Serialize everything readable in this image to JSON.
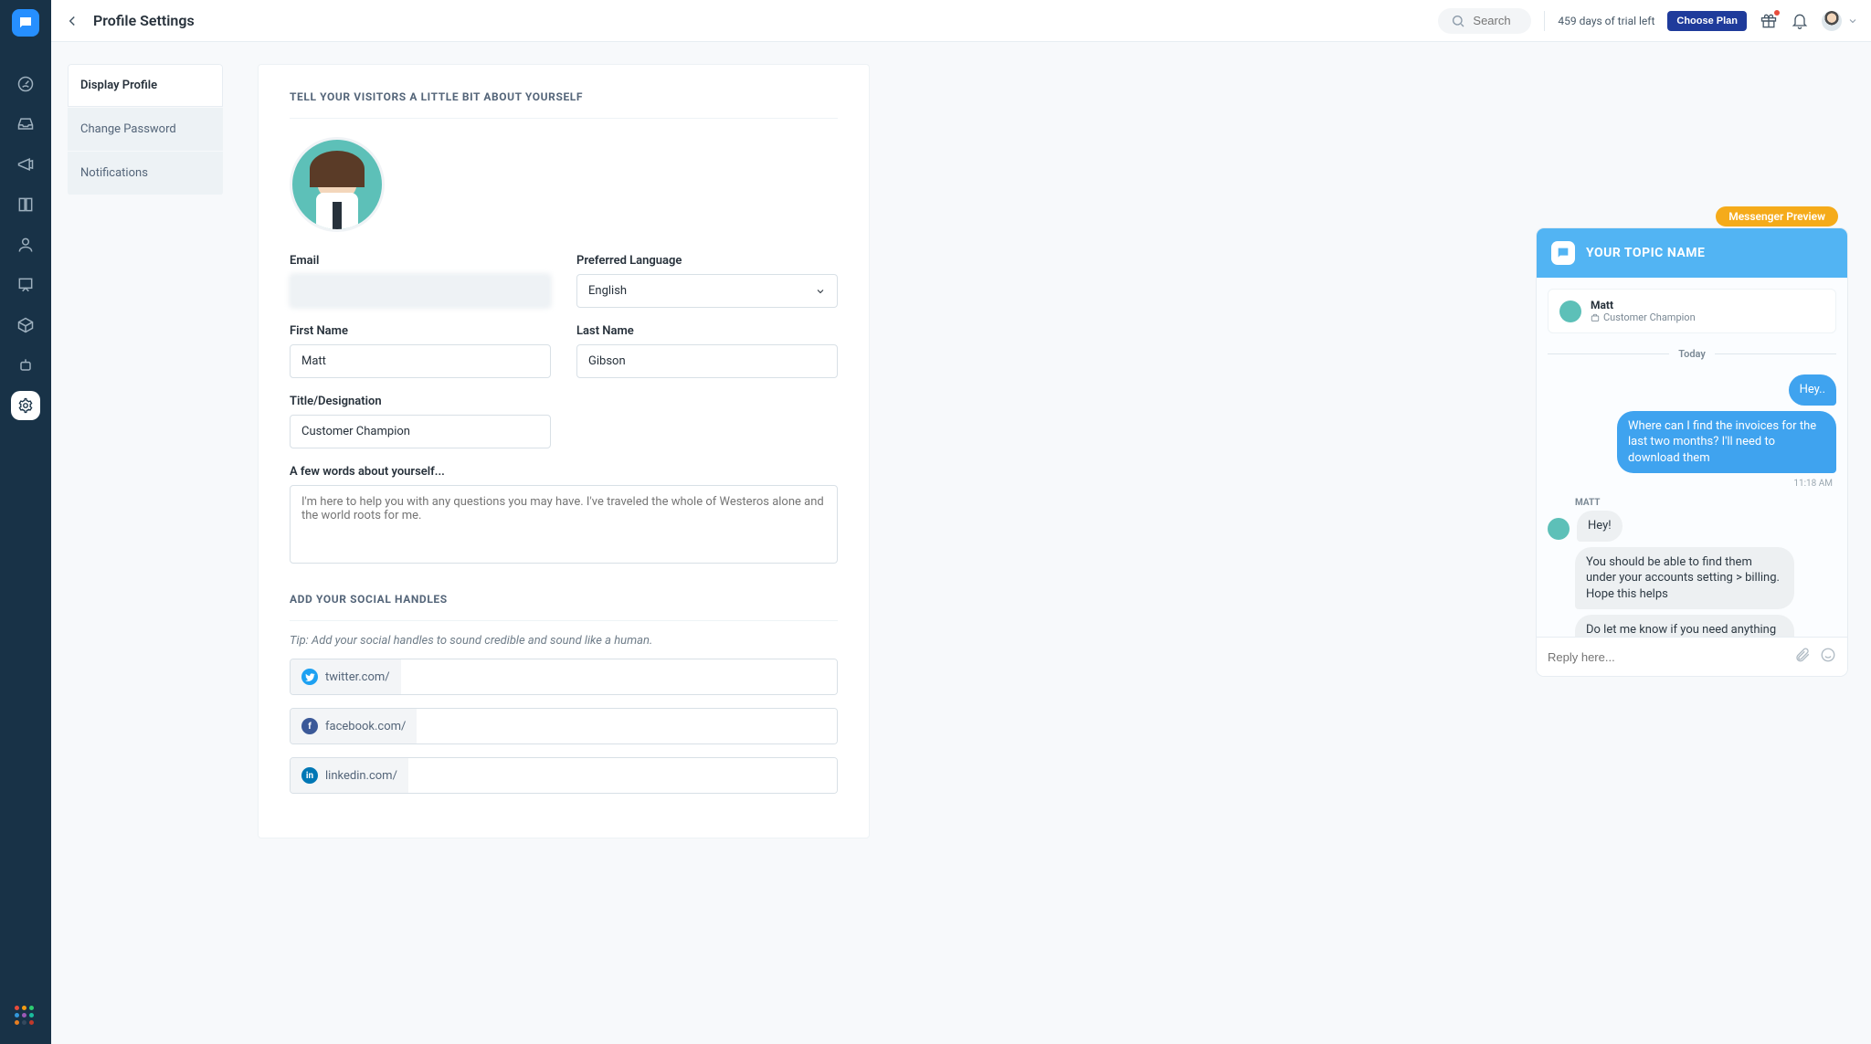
{
  "header": {
    "page_title": "Profile Settings",
    "search_placeholder": "Search",
    "trial_text": "459 days of trial left",
    "choose_plan": "Choose Plan"
  },
  "side_tabs": {
    "display_profile": "Display Profile",
    "change_password": "Change Password",
    "notifications": "Notifications"
  },
  "form": {
    "section_about": "Tell your visitors a little bit about yourself",
    "labels": {
      "email": "Email",
      "language": "Preferred Language",
      "first_name": "First Name",
      "last_name": "Last Name",
      "title": "Title/Designation",
      "bio": "A few words about yourself..."
    },
    "values": {
      "email_masked": "",
      "language": "English",
      "first_name": "Matt",
      "last_name": "Gibson",
      "title": "Customer Champion",
      "bio_placeholder": "I'm here to help you with any questions you may have. I've traveled the whole of Westeros alone and the world roots for me."
    },
    "section_social": "Add your social handles",
    "social_tip": "Tip: Add your social handles to sound credible and sound like a human.",
    "social": {
      "twitter_prefix": "twitter.com/",
      "facebook_prefix": "facebook.com/",
      "linkedin_prefix": "linkedin.com/"
    }
  },
  "preview": {
    "badge": "Messenger Preview",
    "topic": "YOUR TOPIC NAME",
    "agent_name": "Matt",
    "agent_role": "Customer Champion",
    "today": "Today",
    "msgs": {
      "u1": "Hey..",
      "u2": "Where can I find the invoices for the last two months? I'll need to download them",
      "time": "11:18 AM",
      "sender": "MATT",
      "a1": "Hey!",
      "a2": "You should be able to find them under your accounts setting > billing. Hope this helps",
      "a3": "Do let me know if you need anything more. 👋"
    },
    "reply_placeholder": "Reply here..."
  }
}
